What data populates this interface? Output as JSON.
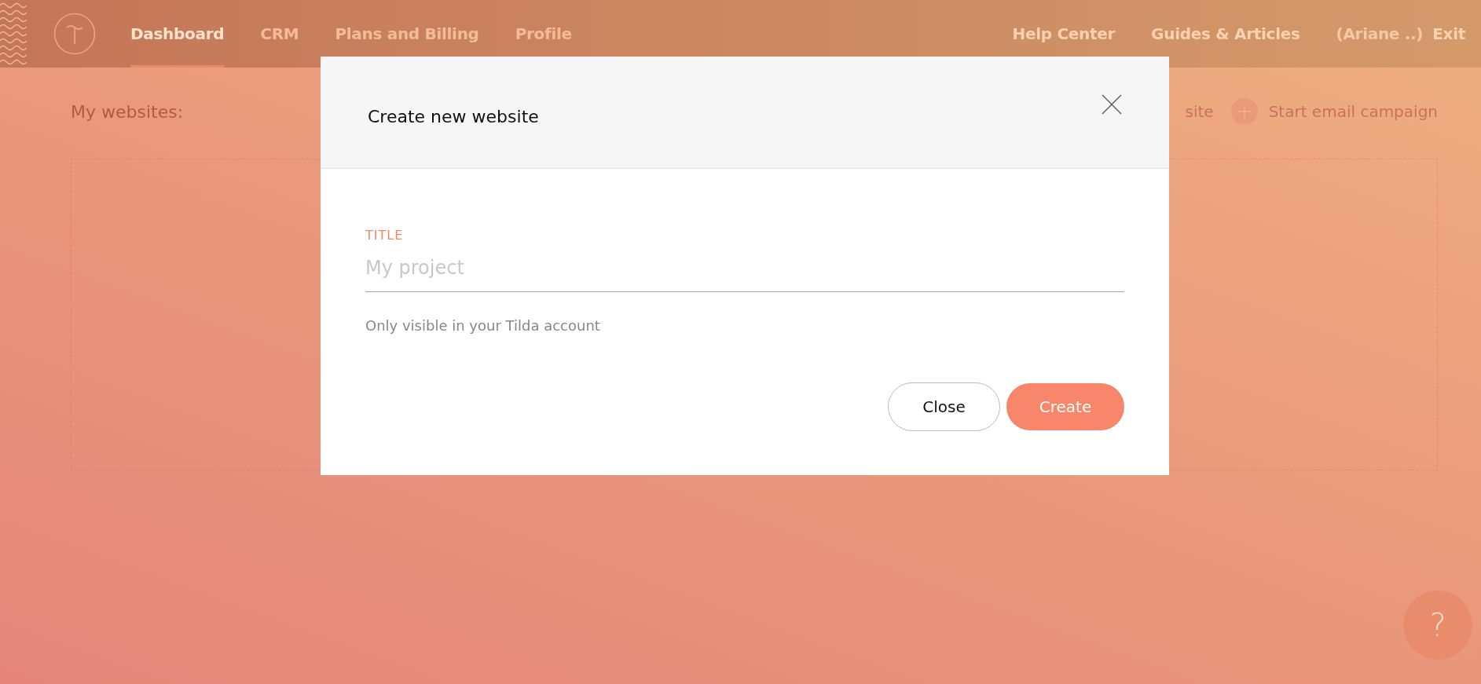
{
  "nav": {
    "items": [
      {
        "label": "Dashboard",
        "selected": true
      },
      {
        "label": "CRM",
        "selected": false
      },
      {
        "label": "Plans and Billing",
        "selected": false
      },
      {
        "label": "Profile",
        "selected": false
      }
    ],
    "right_links": [
      "Help Center",
      "Guides & Articles"
    ],
    "user": "(Ariane ..)",
    "exit": "Exit"
  },
  "dashboard": {
    "heading": "My websites:",
    "actions": [
      {
        "label": "site",
        "icon": false
      },
      {
        "label": "Start email campaign",
        "icon": true
      }
    ]
  },
  "help_button": "?",
  "modal": {
    "title": "Create new website",
    "field": {
      "label": "TITLE",
      "placeholder": "My project",
      "hint": "Only visible in your Tilda account"
    },
    "buttons": [
      {
        "label": "Close",
        "kind": "secondary"
      },
      {
        "label": "Create",
        "kind": "primary"
      }
    ]
  }
}
